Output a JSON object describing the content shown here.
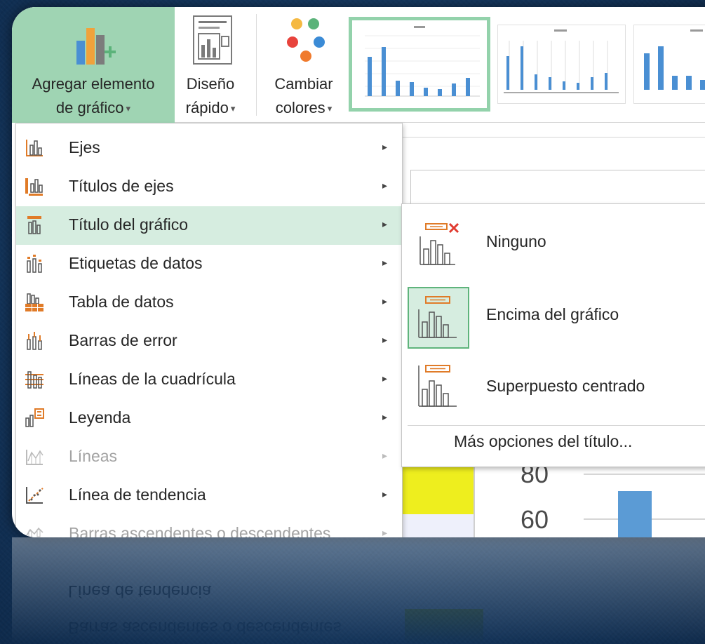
{
  "ribbon": {
    "add_element": {
      "line1": "Agregar elemento",
      "line2": "de gráfico"
    },
    "quick_layout": {
      "line1": "Diseño",
      "line2": "rápido"
    },
    "change_colors": {
      "line1": "Cambiar",
      "line2": "colores"
    },
    "caret": "▾"
  },
  "menu": {
    "items": [
      {
        "label": "Ejes",
        "arrow": "▸",
        "disabled": false,
        "highlighted": false
      },
      {
        "label": "Títulos de ejes",
        "arrow": "▸",
        "disabled": false,
        "highlighted": false
      },
      {
        "label": "Título del gráfico",
        "arrow": "▸",
        "disabled": false,
        "highlighted": true
      },
      {
        "label": "Etiquetas de datos",
        "arrow": "▸",
        "disabled": false,
        "highlighted": false
      },
      {
        "label": "Tabla de datos",
        "arrow": "▸",
        "disabled": false,
        "highlighted": false
      },
      {
        "label": "Barras de error",
        "arrow": "▸",
        "disabled": false,
        "highlighted": false
      },
      {
        "label": "Líneas de la cuadrícula",
        "arrow": "▸",
        "disabled": false,
        "highlighted": false
      },
      {
        "label": "Leyenda",
        "arrow": "▸",
        "disabled": false,
        "highlighted": false
      },
      {
        "label": "Líneas",
        "arrow": "▸",
        "disabled": true,
        "highlighted": false
      },
      {
        "label": "Línea de tendencia",
        "arrow": "▸",
        "disabled": false,
        "highlighted": false
      },
      {
        "label": "Barras ascendentes o descendentes",
        "arrow": "▸",
        "disabled": true,
        "highlighted": false
      }
    ]
  },
  "submenu": {
    "options": [
      {
        "label": "Ninguno",
        "selected": false
      },
      {
        "label": "Encima del gráfico",
        "selected": true
      },
      {
        "label": "Superpuesto centrado",
        "selected": false
      }
    ],
    "more": "Más opciones del título..."
  },
  "chart_axis": {
    "tick_80": "80",
    "tick_60": "60"
  },
  "colors": {
    "accent_green": "#9fd4b3",
    "highlight_green": "#d6ede0",
    "icon_orange": "#e07b28",
    "bar_blue": "#5b9bd5"
  }
}
